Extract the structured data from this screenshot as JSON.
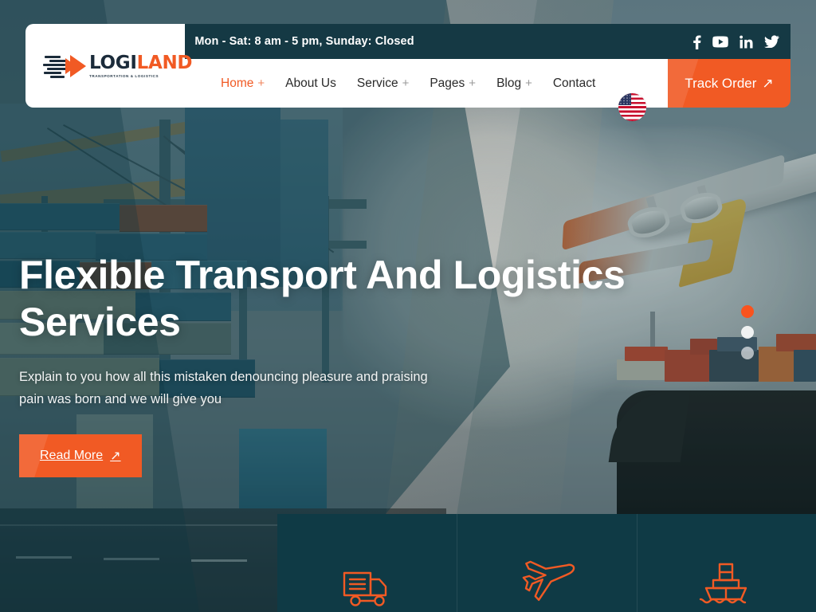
{
  "header": {
    "hours_text": "Mon - Sat: 8 am - 5 pm, Sunday: Closed",
    "logo": {
      "name_part1": "LOGI",
      "name_part2": "LAND",
      "tagline": "TRANSPORTATION & LOGISTICS",
      "mark_icon": "speed-arrow-icon"
    },
    "socials": [
      {
        "name": "facebook-icon",
        "label": "Facebook"
      },
      {
        "name": "youtube-icon",
        "label": "YouTube"
      },
      {
        "name": "linkedin-icon",
        "label": "LinkedIn"
      },
      {
        "name": "twitter-icon",
        "label": "Twitter"
      }
    ],
    "nav": [
      {
        "label": "Home",
        "plus": "+",
        "active": true
      },
      {
        "label": "About Us",
        "plus": "",
        "active": false
      },
      {
        "label": "Service",
        "plus": "+",
        "active": false
      },
      {
        "label": "Pages",
        "plus": "+",
        "active": false
      },
      {
        "label": "Blog",
        "plus": "+",
        "active": false
      },
      {
        "label": "Contact",
        "plus": "",
        "active": false
      }
    ],
    "language_flag": "us-flag-icon",
    "track_order": {
      "label": "Track Order",
      "arrow": "↗"
    }
  },
  "hero": {
    "title": "Flexible Transport And Logistics Services",
    "subtitle": "Explain to you how all this mistaken denouncing pleasure and praising pain was born and we will give you",
    "cta": {
      "label": "Read More",
      "arrow": "↗"
    },
    "slider_dots": [
      {
        "state": "active"
      },
      {
        "state": "inactive"
      },
      {
        "state": "inactive"
      }
    ]
  },
  "services": [
    {
      "icon": "delivery-truck-icon"
    },
    {
      "icon": "airplane-icon"
    },
    {
      "icon": "cargo-ship-icon"
    }
  ],
  "colors": {
    "accent_orange": "#f15a24",
    "dark_teal": "#153944",
    "panel_teal": "#0f3a45",
    "logo_navy": "#1b2b3a",
    "white": "#ffffff"
  }
}
